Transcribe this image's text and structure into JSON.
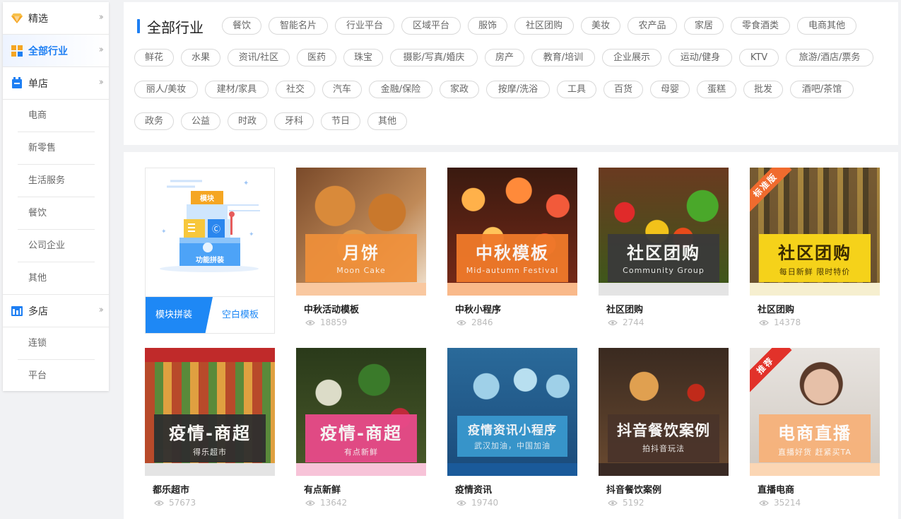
{
  "sidebar": {
    "groups": [
      {
        "label": "精选",
        "icon": "diamond-icon"
      },
      {
        "label": "全部行业",
        "icon": "grid-icon",
        "active": true
      },
      {
        "label": "单店",
        "icon": "shop-icon"
      },
      {
        "label": "多店",
        "icon": "chain-icon"
      }
    ],
    "dandian_items": [
      "电商",
      "新零售",
      "生活服务",
      "餐饮",
      "公司企业",
      "其他"
    ],
    "duodian_items": [
      "连锁",
      "平台"
    ]
  },
  "filter": {
    "title": "全部行业",
    "tags": [
      "餐饮",
      "智能名片",
      "行业平台",
      "区域平台",
      "服饰",
      "社区团购",
      "美妆",
      "农产品",
      "家居",
      "零食酒类",
      "电商其他",
      "鲜花",
      "水果",
      "资讯/社区",
      "医药",
      "珠宝",
      "摄影/写真/婚庆",
      "房产",
      "教育/培训",
      "企业展示",
      "运动/健身",
      "KTV",
      "旅游/酒店/票务",
      "丽人/美妆",
      "建材/家具",
      "社交",
      "汽车",
      "金融/保险",
      "家政",
      "按摩/洗浴",
      "工具",
      "百货",
      "母婴",
      "蛋糕",
      "批发",
      "酒吧/茶馆",
      "政务",
      "公益",
      "时政",
      "牙科",
      "节日",
      "其他"
    ]
  },
  "module_card": {
    "btn_module": "模块拼装",
    "btn_blank": "空白模板",
    "illus_badge_top": "模块",
    "illus_badge_bottom": "功能拼装"
  },
  "templates": [
    {
      "title": "中秋活动模板",
      "views": "18859",
      "overlay_big": "月饼",
      "overlay_small": "Moon Cake",
      "ribbon": ""
    },
    {
      "title": "中秋小程序",
      "views": "2846",
      "overlay_big": "中秋模板",
      "overlay_small": "Mid-autumn Festival",
      "ribbon": ""
    },
    {
      "title": "社区团购",
      "views": "2744",
      "overlay_big": "社区团购",
      "overlay_small": "Community Group",
      "ribbon": ""
    },
    {
      "title": "社区团购",
      "views": "14378",
      "overlay_big": "社区团购",
      "overlay_small": "每日新鲜 限时特价",
      "ribbon": "标准版"
    },
    {
      "title": "都乐超市",
      "views": "57673",
      "overlay_big": "疫情-商超",
      "overlay_small": "得乐超市",
      "ribbon": ""
    },
    {
      "title": "有点新鲜",
      "views": "13642",
      "overlay_big": "疫情-商超",
      "overlay_small": "有点新鲜",
      "ribbon": ""
    },
    {
      "title": "疫情资讯",
      "views": "19740",
      "overlay_big": "疫情资讯小程序",
      "overlay_small": "武汉加油，中国加油",
      "ribbon": ""
    },
    {
      "title": "抖音餐饮案例",
      "views": "5192",
      "overlay_big": "抖音餐饮案例",
      "overlay_small": "拍抖音玩法",
      "ribbon": ""
    },
    {
      "title": "直播电商",
      "views": "35214",
      "overlay_big": "电商直播",
      "overlay_small": "直播好货 赶紧买TA",
      "ribbon": "推荐"
    }
  ],
  "colors": {
    "accent": "#1e7ff3"
  }
}
